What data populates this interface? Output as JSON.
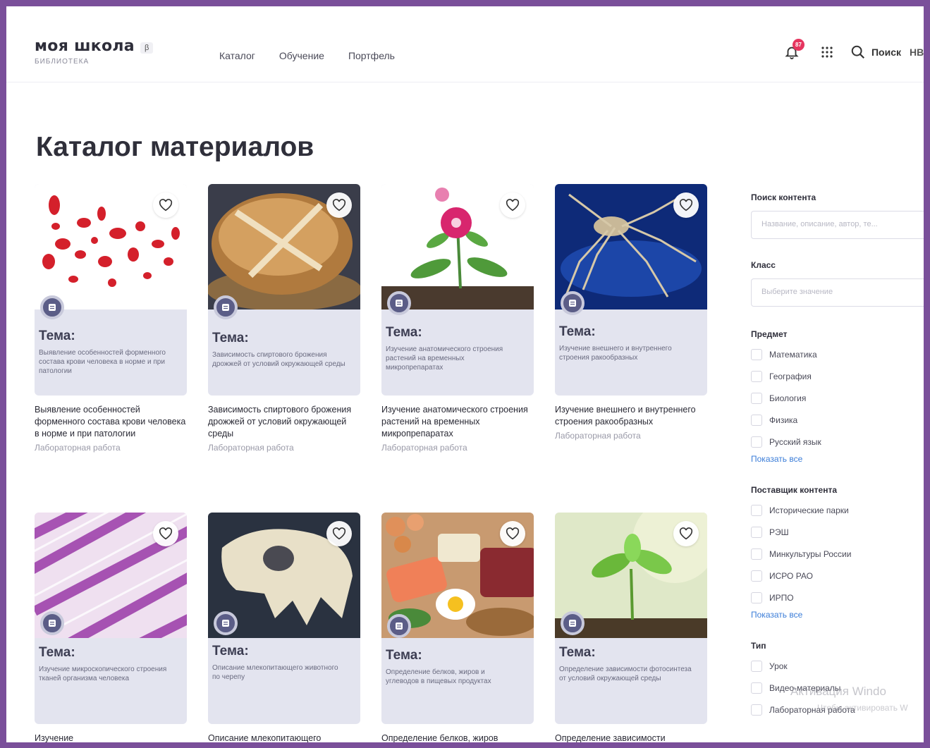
{
  "header": {
    "logo": "моя школа",
    "beta": "β",
    "logo_sub": "БИБЛИОТЕКА",
    "nav": [
      "Каталог",
      "Обучение",
      "Портфель"
    ],
    "notifications_count": "87",
    "search_label": "Поиск",
    "user_initials": "НВ"
  },
  "page_title": "Каталог материалов",
  "cards": [
    {
      "tema": "Тема:",
      "desc": "Выявление особенностей форменного состава крови человека в норме и при патологии",
      "title": "Выявление особенностей форменного состава крови человека в норме и при патологии",
      "type": "Лабораторная работа"
    },
    {
      "tema": "Тема:",
      "desc": "Зависимость спиртового брожения дрожжей от условий окружающей среды",
      "title": "Зависимость спиртового брожения дрожжей от условий окружающей среды",
      "type": "Лабораторная работа"
    },
    {
      "tema": "Тема:",
      "desc": "Изучение анатомического строения растений на временных микропрепаратах",
      "title": "Изучение анатомического строения растений на временных микропрепаратах",
      "type": "Лабораторная работа"
    },
    {
      "tema": "Тема:",
      "desc": "Изучение внешнего и внутреннего строения ракообразных",
      "title": "Изучение внешнего и внутреннего строения ракообразных",
      "type": "Лабораторная работа"
    },
    {
      "tema": "Тема:",
      "desc": "Изучение микроскопического строения тканей организма человека",
      "title": "Изучение",
      "type": ""
    },
    {
      "tema": "Тема:",
      "desc": "Описание млекопитающего животного по черепу",
      "title": "Описание млекопитающего",
      "type": ""
    },
    {
      "tema": "Тема:",
      "desc": "Определение белков, жиров и углеводов в пищевых продуктах",
      "title": "Определение белков, жиров",
      "type": ""
    },
    {
      "tema": "Тема:",
      "desc": "Определение зависимости фотосинтеза от условий окружающей среды",
      "title": "Определение зависимости",
      "type": ""
    }
  ],
  "sidebar": {
    "search_heading": "Поиск контента",
    "search_placeholder": "Название, описание, автор, те...",
    "class_heading": "Класс",
    "class_placeholder": "Выберите значение",
    "subject_heading": "Предмет",
    "subjects": [
      "Математика",
      "География",
      "Биология",
      "Физика",
      "Русский язык"
    ],
    "show_all": "Показать все",
    "provider_heading": "Поставщик контента",
    "providers": [
      "Исторические парки",
      "РЭШ",
      "Минкультуры России",
      "ИСРО РАО",
      "ИРПО"
    ],
    "type_heading": "Тип",
    "types": [
      "Урок",
      "Видео-материалы",
      "Лабораторная работа"
    ]
  },
  "watermark": {
    "line1": "Активация Windo",
    "line2": "Чтобы активировать W"
  },
  "colors": {
    "frame": "#7a4f9a",
    "accent": "#3b7dd8",
    "badge": "#e6355f",
    "card_bg": "#e3e4ef"
  }
}
